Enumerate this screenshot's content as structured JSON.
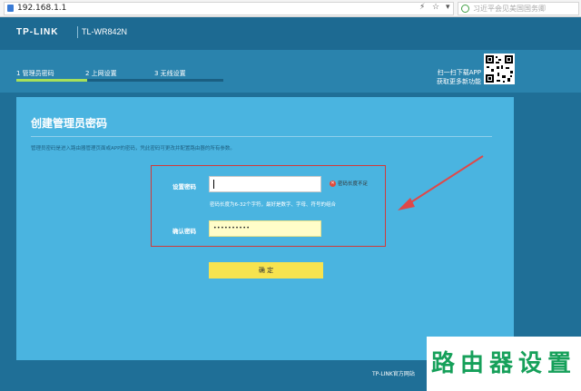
{
  "browser": {
    "url": "192.168.1.1",
    "search_placeholder": "习近平会见美国国务卿"
  },
  "header": {
    "logo": "TP-LINK",
    "model": "TL-WR842N"
  },
  "steps": [
    {
      "label": "1 管理员密码"
    },
    {
      "label": "2 上网设置"
    },
    {
      "label": "3 无线设置"
    }
  ],
  "steps_progress": 0.34,
  "app_promo": {
    "line1": "扫一扫下载APP",
    "line2": "获取更多新功能"
  },
  "form": {
    "title": "创建管理员密码",
    "description": "管理员密码是进入路由器管理页面或APP的密码，凭此密码可更改并配置路由器的所有参数。",
    "password_label": "设置密码",
    "password_value": "",
    "error_text": "密码长度不足",
    "hint": "密码长度为6-32个字符，最好是数字、字母、符号的组合",
    "confirm_label": "确认密码",
    "confirm_value": "••••••••••",
    "submit_label": "确 定"
  },
  "footer": {
    "link": "TP-LINK官方网站"
  },
  "watermark": "路由器设置"
}
